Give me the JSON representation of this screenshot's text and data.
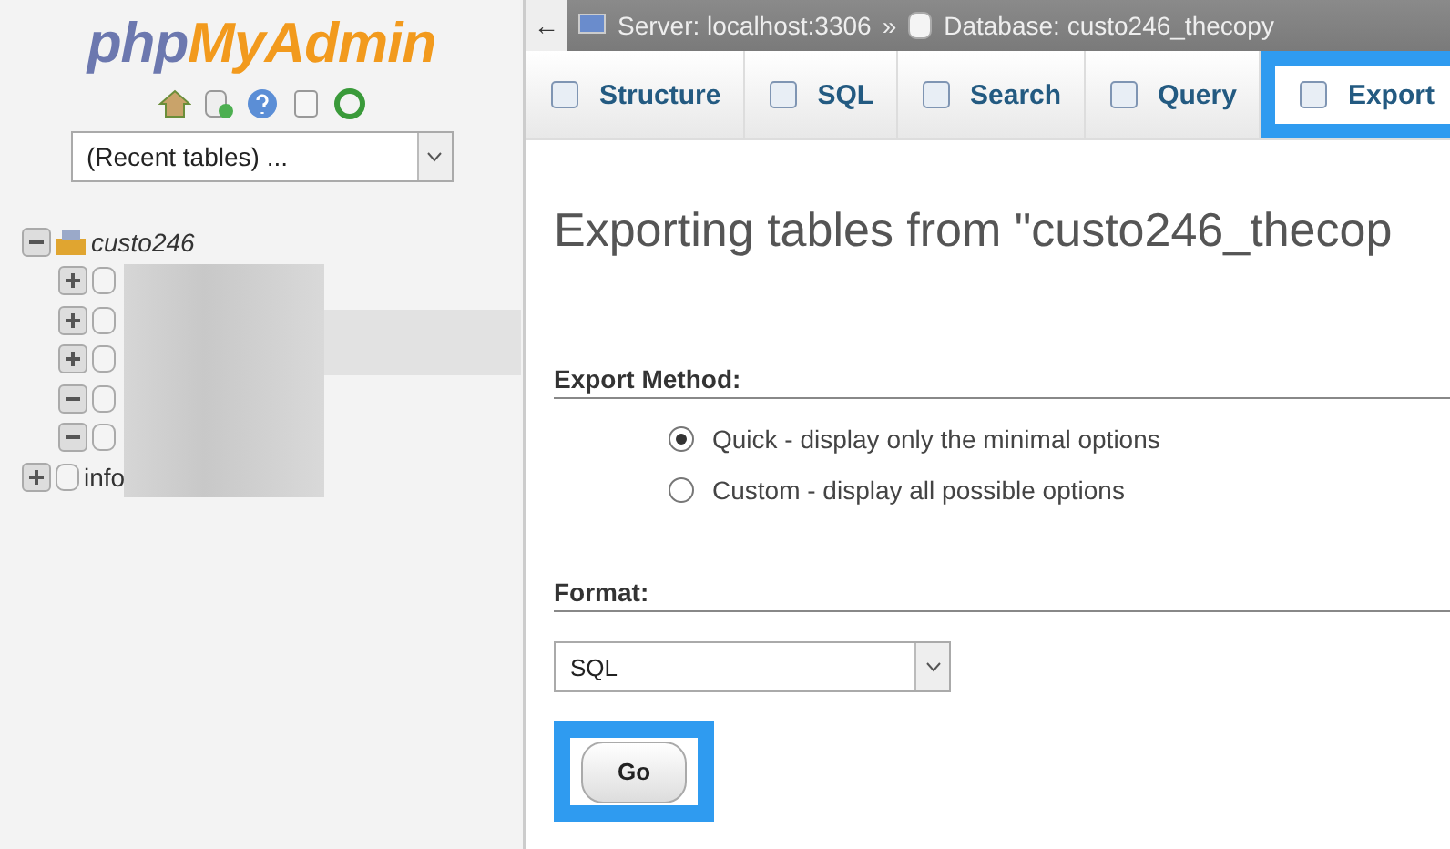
{
  "sidebar": {
    "logo": {
      "prefix": "php",
      "name": "MyAdmin"
    },
    "recent_tables": {
      "value": "(Recent tables) ..."
    },
    "tree": [
      {
        "label": "custo246",
        "expanded": true,
        "children": [
          {
            "expanded": false
          },
          {
            "expanded": false
          },
          {
            "expanded": false
          },
          {
            "expanded": true
          },
          {
            "expanded": true
          }
        ]
      },
      {
        "label": "info",
        "expanded": false
      }
    ]
  },
  "breadcrumb": {
    "back": "←",
    "server": "Server: localhost:3306",
    "separator": "»",
    "database": "Database: custo246_thecopy"
  },
  "tabs": [
    {
      "label": "Structure",
      "selected": false,
      "highlighted": false
    },
    {
      "label": "SQL",
      "selected": false,
      "highlighted": false
    },
    {
      "label": "Search",
      "selected": false,
      "highlighted": false
    },
    {
      "label": "Query",
      "selected": false,
      "highlighted": false
    },
    {
      "label": "Export",
      "selected": true,
      "highlighted": true
    }
  ],
  "heading": "Exporting tables from \"custo246_thecop",
  "export_method": {
    "title": "Export Method:",
    "options": [
      {
        "label": "Quick - display only the minimal options",
        "selected": true
      },
      {
        "label": "Custom - display all possible options",
        "selected": false
      }
    ]
  },
  "format": {
    "title": "Format:",
    "value": "SQL"
  },
  "go_button": {
    "label": "Go",
    "highlighted": true
  }
}
